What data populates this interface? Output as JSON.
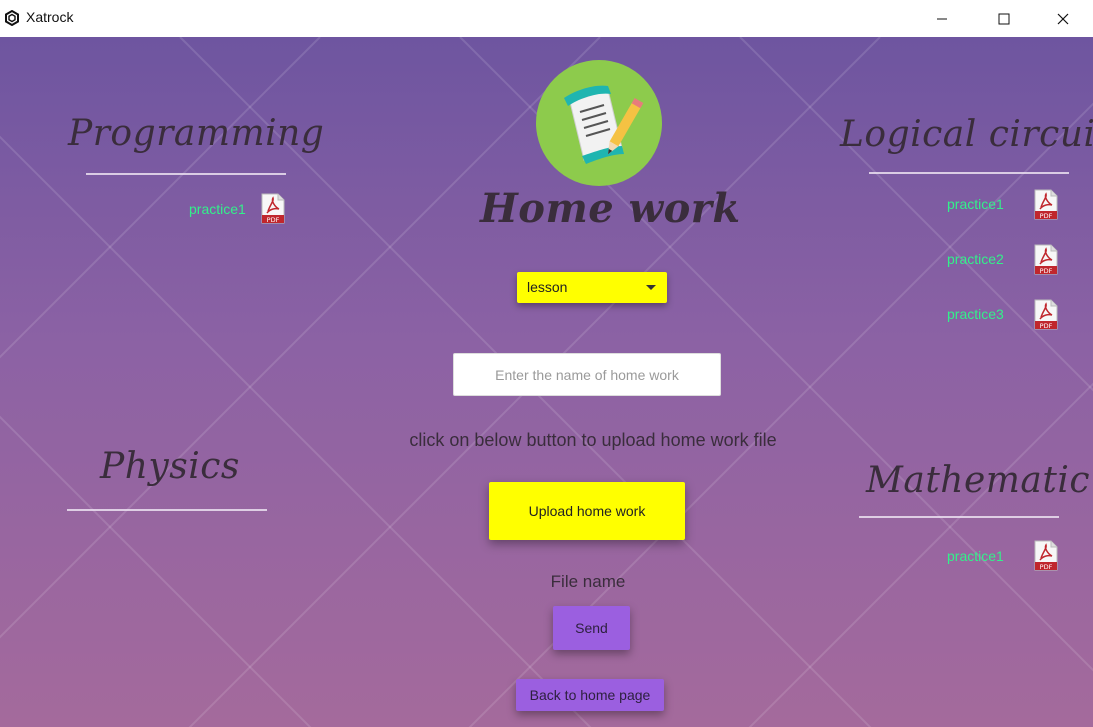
{
  "window": {
    "title": "Xatrock",
    "icon": "app-hexagon-icon"
  },
  "header": {
    "title": "Home work",
    "logo_icon": "homework-scroll-pencil-icon"
  },
  "sections": {
    "programming": {
      "title": "Programming",
      "files": [
        "practice1"
      ]
    },
    "logical_circuit": {
      "title": "Logical circuit",
      "files": [
        "practice1",
        "practice2",
        "practice3"
      ]
    },
    "physics": {
      "title": "Physics",
      "files": []
    },
    "mathematic": {
      "title": "Mathematic",
      "files": [
        "practice1"
      ]
    }
  },
  "form": {
    "lesson_select": {
      "value": "lesson"
    },
    "homework_name": {
      "placeholder": "Enter the name of home work",
      "value": ""
    },
    "instruction": "click on below button to upload home work file",
    "upload_label": "Upload home work",
    "file_name_label": "File name",
    "send_label": "Send",
    "back_label": "Back to home page"
  },
  "colors": {
    "background_top": "#6e55a0",
    "background_bottom": "#a46a9c",
    "accent_yellow": "#ffff00",
    "button_purple": "#9b5fe0",
    "link_green": "#33f08a",
    "heading_text": "#3a2d3c"
  }
}
